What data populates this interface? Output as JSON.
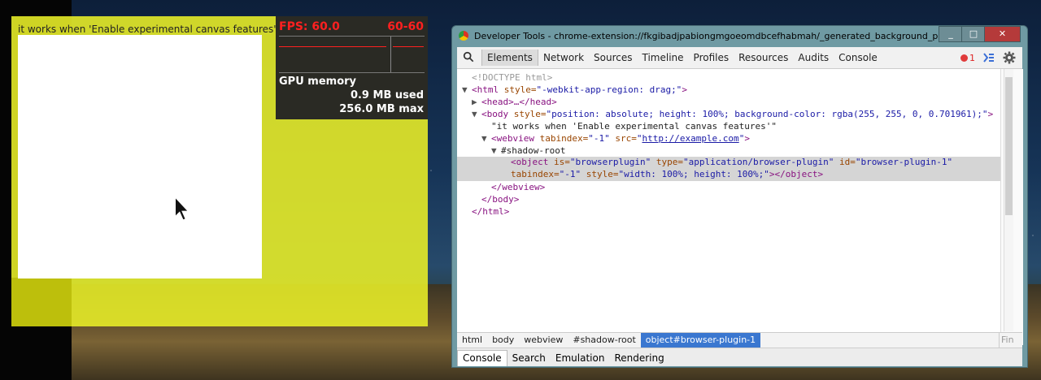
{
  "app": {
    "text": "it works when 'Enable experimental canvas features'"
  },
  "fps": {
    "label": "FPS: 60.0",
    "range": "60-60",
    "gpu_title": "GPU memory",
    "gpu_used": "0.9 MB used",
    "gpu_max": "256.0 MB max"
  },
  "devtools": {
    "title": "Developer Tools - chrome-extension://fkgibadjpabiongmgoeomdbcefhabmah/_generated_background_page.html",
    "tabs": [
      "Elements",
      "Network",
      "Sources",
      "Timeline",
      "Profiles",
      "Resources",
      "Audits",
      "Console"
    ],
    "active_tab": "Elements",
    "error_count": "1",
    "dom": {
      "doctype": "<!DOCTYPE html>",
      "html_open_tag": "<html",
      "html_style_attr": "style=",
      "html_style_val": "\"-webkit-app-region: drag;\"",
      "html_close_bracket": ">",
      "head_collapsed": "<head>…</head>",
      "body_open_tag": "<body",
      "body_style_attr": "style=",
      "body_style_val": "\"position: absolute; height: 100%; background-color: rgba(255, 255, 0, 0.701961);\"",
      "body_close_bracket": ">",
      "text_node": "\"it works when 'Enable experimental canvas features'\"",
      "webview_open_tag": "<webview",
      "webview_tabindex_attr": "tabindex=",
      "webview_tabindex_val": "\"-1\"",
      "webview_src_attr": "src=",
      "webview_src_quote_open": "\"",
      "webview_src_val": "http://example.com",
      "webview_src_quote_close": "\"",
      "webview_close_bracket": ">",
      "shadow_root": "#shadow-root",
      "object_open_tag": "<object",
      "object_is_attr": "is=",
      "object_is_val": "\"browserplugin\"",
      "object_type_attr": "type=",
      "object_type_val": "\"application/browser-plugin\"",
      "object_id_attr": "id=",
      "object_id_val": "\"browser-plugin-1\"",
      "object_tabindex_attr": "tabindex=",
      "object_tabindex_val": "\"-1\"",
      "object_style_attr": "style=",
      "object_style_val": "\"width: 100%; height: 100%;\"",
      "object_close": "></object>",
      "webview_close": "</webview>",
      "body_close": "</body>",
      "html_close": "</html>"
    },
    "breadcrumbs": [
      "html",
      "body",
      "webview",
      "#shadow-root",
      "object#browser-plugin-1"
    ],
    "find_placeholder": "Fin",
    "drawer_tabs": [
      "Console",
      "Search",
      "Emulation",
      "Rendering"
    ],
    "active_drawer_tab": "Console"
  }
}
